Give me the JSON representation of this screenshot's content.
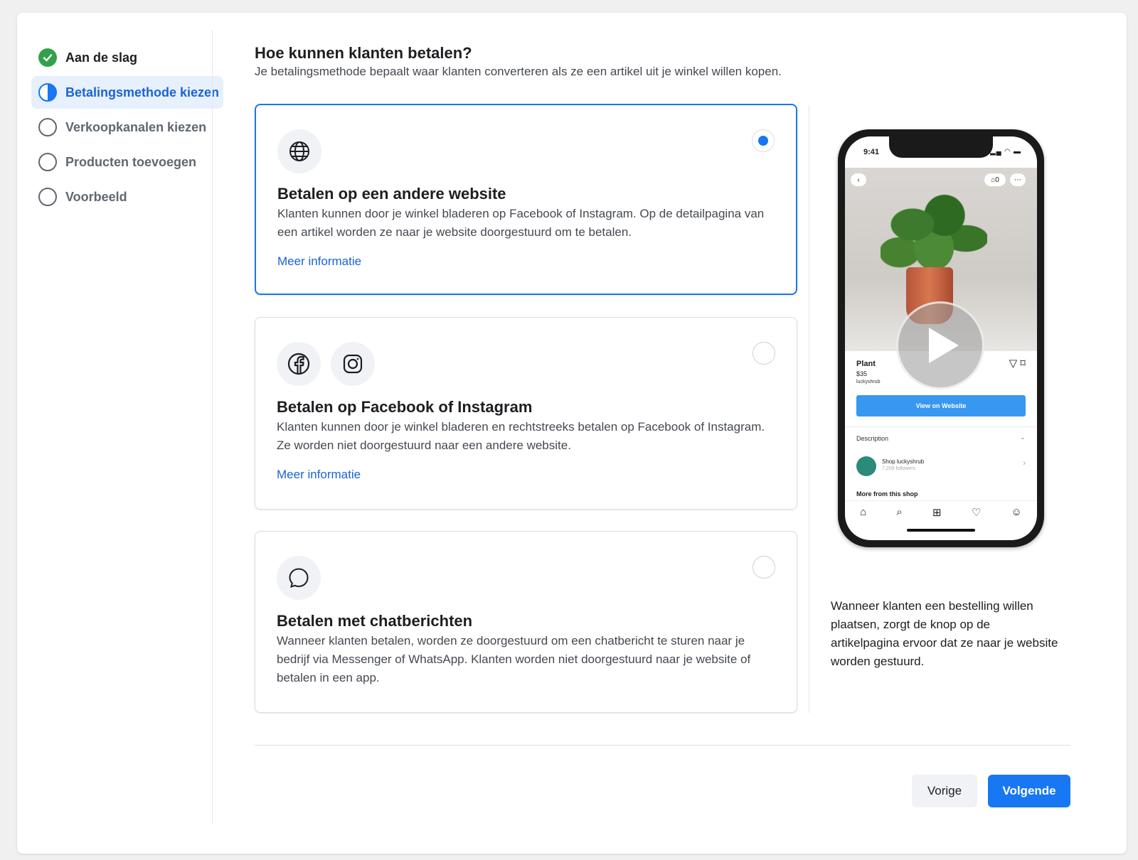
{
  "sidebar": {
    "steps": [
      {
        "label": "Aan de slag",
        "state": "done"
      },
      {
        "label": "Betalingsmethode kiezen",
        "state": "active"
      },
      {
        "label": "Verkoopkanalen kiezen",
        "state": "todo"
      },
      {
        "label": "Producten toevoegen",
        "state": "todo"
      },
      {
        "label": "Voorbeeld",
        "state": "todo"
      }
    ]
  },
  "main": {
    "title": "Hoe kunnen klanten betalen?",
    "subtitle": "Je betalingsmethode bepaalt waar klanten converteren als ze een artikel uit je winkel willen kopen.",
    "options": [
      {
        "title": "Betalen op een andere website",
        "description": "Klanten kunnen door je winkel bladeren op Facebook of Instagram. Op de detailpagina van een artikel worden ze naar je website doorgestuurd om te betalen.",
        "link": "Meer informatie",
        "icons": [
          "globe-icon"
        ],
        "selected": true
      },
      {
        "title": "Betalen op Facebook of Instagram",
        "description": "Klanten kunnen door je winkel bladeren en rechtstreeks betalen op Facebook of Instagram. Ze worden niet doorgestuurd naar een andere website.",
        "link": "Meer informatie",
        "icons": [
          "facebook-icon",
          "instagram-icon"
        ],
        "selected": false
      },
      {
        "title": "Betalen met chatberichten",
        "description": "Wanneer klanten betalen, worden ze doorgestuurd om een chatbericht te sturen naar je bedrijf via Messenger of WhatsApp. Klanten worden niet doorgestuurd naar je website of betalen in een app.",
        "icons": [
          "chat-bubble-icon"
        ],
        "selected": false
      }
    ]
  },
  "preview": {
    "time": "9:41",
    "cart_count": "0",
    "product_name": "Plant",
    "price": "$35",
    "shop_handle": "luckyshrub",
    "view_button": "View on Website",
    "description_label": "Description",
    "shop_name": "Shop luckyshrub",
    "followers": "7,209 followers",
    "more_from": "More from this shop",
    "caption": "Wanneer klanten een bestelling willen plaatsen, zorgt de knop op de artikelpagina ervoor dat ze naar je website worden gestuurd."
  },
  "footer": {
    "prev_label": "Vorige",
    "next_label": "Volgende"
  },
  "colors": {
    "accent": "#1877f2",
    "link": "#1a63d3",
    "success": "#31a24c"
  }
}
